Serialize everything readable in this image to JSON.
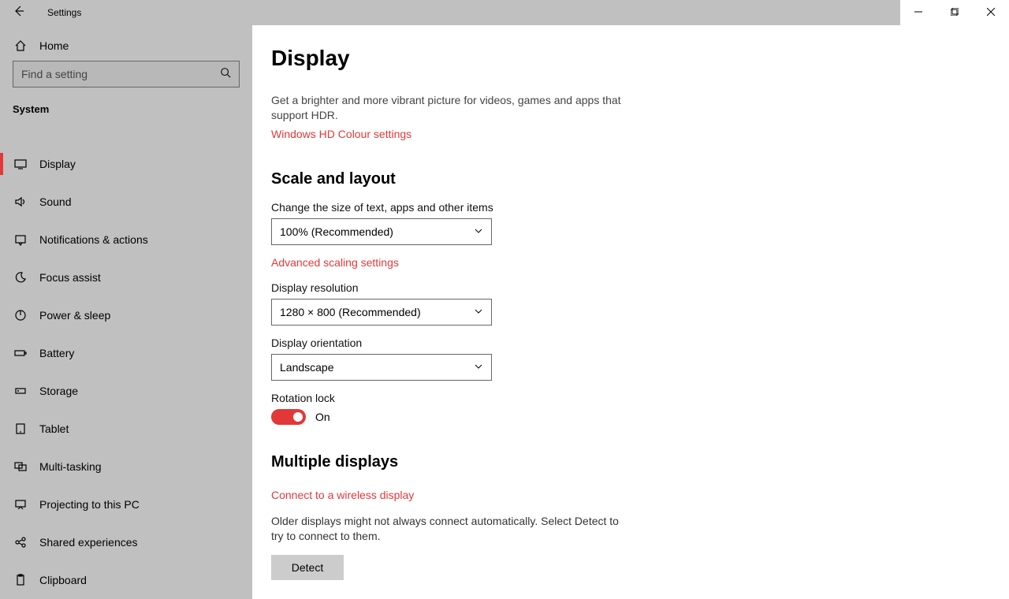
{
  "titlebar": {
    "app_title": "Settings"
  },
  "sidebar": {
    "home_label": "Home",
    "search_placeholder": "Find a setting",
    "section_label": "System",
    "items": [
      {
        "label": "Display",
        "icon": "monitor"
      },
      {
        "label": "Sound",
        "icon": "sound"
      },
      {
        "label": "Notifications & actions",
        "icon": "notification"
      },
      {
        "label": "Focus assist",
        "icon": "moon"
      },
      {
        "label": "Power & sleep",
        "icon": "power"
      },
      {
        "label": "Battery",
        "icon": "battery"
      },
      {
        "label": "Storage",
        "icon": "storage"
      },
      {
        "label": "Tablet",
        "icon": "tablet"
      },
      {
        "label": "Multi-tasking",
        "icon": "multitask"
      },
      {
        "label": "Projecting to this PC",
        "icon": "project"
      },
      {
        "label": "Shared experiences",
        "icon": "share"
      },
      {
        "label": "Clipboard",
        "icon": "clipboard"
      }
    ]
  },
  "main": {
    "page_title": "Display",
    "hdr_desc": "Get a brighter and more vibrant picture for videos, games and apps that support HDR.",
    "hdr_link": "Windows HD Colour settings",
    "scale_heading": "Scale and layout",
    "scale_label": "Change the size of text, apps and other items",
    "scale_value": "100% (Recommended)",
    "adv_scaling_link": "Advanced scaling settings",
    "resolution_label": "Display resolution",
    "resolution_value": "1280 × 800 (Recommended)",
    "orientation_label": "Display orientation",
    "orientation_value": "Landscape",
    "rotation_label": "Rotation lock",
    "rotation_state": "On",
    "multi_heading": "Multiple displays",
    "wireless_link": "Connect to a wireless display",
    "detect_desc": "Older displays might not always connect automatically. Select Detect to try to connect to them.",
    "detect_button": "Detect"
  }
}
